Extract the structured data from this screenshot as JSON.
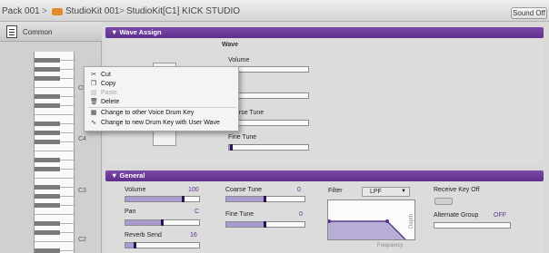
{
  "breadcrumb": {
    "pack": "Pack 001",
    "kit": "StudioKit 001",
    "key": "StudioKit[C1] KICK STUDIO",
    "sep": ">"
  },
  "toolbar": {
    "sound_off": "Sound Off"
  },
  "sidebar": {
    "common_label": "Common",
    "expand_glyph": ">",
    "octaves": [
      "C5",
      "C4",
      "C3",
      "C2"
    ]
  },
  "wave_assign": {
    "header": "▼ Wave Assign",
    "wave_title": "Wave",
    "volume_label": "Volume",
    "coarse_tune_label": "arse Tune",
    "fine_tune_label": "Fine Tune",
    "fine_tune_level": 0.03
  },
  "general": {
    "header": "▼ General",
    "volume_label": "Volume",
    "volume_value": "100",
    "volume_level": 0.79,
    "pan_label": "Pan",
    "pan_value": "C",
    "pan_level": 0.5,
    "reverb_label": "Reverb Send",
    "reverb_value": "16",
    "reverb_level": 0.13,
    "coarse_label": "Coarse Tune",
    "coarse_value": "0",
    "coarse_level": 0.5,
    "fine_label": "Fine Tune",
    "fine_value": "0",
    "fine_level": 0.5,
    "filter_label": "Filter",
    "filter_value": "LPF",
    "filter_arrow": "▼",
    "depth_label": "Depth",
    "frequency_label": "Frequency",
    "receive_key_off_label": "Receive Key Off",
    "alt_group_label": "Alternate Group",
    "alt_group_value": "OFF"
  },
  "context_menu": {
    "items": [
      {
        "label": "Cut",
        "icon": "scissors-icon",
        "glyph": "✂",
        "enabled": true
      },
      {
        "label": "Copy",
        "icon": "copy-icon",
        "glyph": "❐",
        "enabled": true
      },
      {
        "label": "Paste",
        "icon": "paste-icon",
        "glyph": "▤",
        "enabled": false
      },
      {
        "label": "Delete",
        "icon": "trash-icon",
        "glyph": "🗑",
        "enabled": true
      },
      {
        "label": "Change to other Voice Drum Key",
        "icon": "drum-key-icon",
        "glyph": "▦",
        "enabled": true
      },
      {
        "label": "Change to new Drum Key with User Wave",
        "icon": "user-wave-icon",
        "glyph": "∿",
        "enabled": true
      }
    ]
  },
  "colors": {
    "accent": "#5d2f8b",
    "value_text": "#5b2d90",
    "slider_fill": "#a99ad0"
  }
}
